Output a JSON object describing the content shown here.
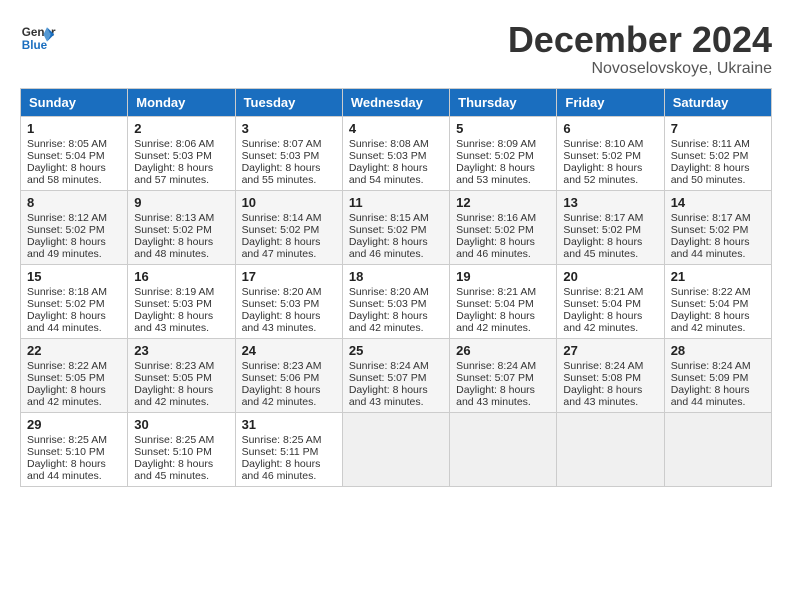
{
  "logo": {
    "line1": "General",
    "line2": "Blue"
  },
  "title": "December 2024",
  "location": "Novoselovskoye, Ukraine",
  "days_header": [
    "Sunday",
    "Monday",
    "Tuesday",
    "Wednesday",
    "Thursday",
    "Friday",
    "Saturday"
  ],
  "weeks": [
    [
      {
        "day": "1",
        "sunrise": "8:05 AM",
        "sunset": "5:04 PM",
        "daylight": "8 hours and 58 minutes."
      },
      {
        "day": "2",
        "sunrise": "8:06 AM",
        "sunset": "5:03 PM",
        "daylight": "8 hours and 57 minutes."
      },
      {
        "day": "3",
        "sunrise": "8:07 AM",
        "sunset": "5:03 PM",
        "daylight": "8 hours and 55 minutes."
      },
      {
        "day": "4",
        "sunrise": "8:08 AM",
        "sunset": "5:03 PM",
        "daylight": "8 hours and 54 minutes."
      },
      {
        "day": "5",
        "sunrise": "8:09 AM",
        "sunset": "5:02 PM",
        "daylight": "8 hours and 53 minutes."
      },
      {
        "day": "6",
        "sunrise": "8:10 AM",
        "sunset": "5:02 PM",
        "daylight": "8 hours and 52 minutes."
      },
      {
        "day": "7",
        "sunrise": "8:11 AM",
        "sunset": "5:02 PM",
        "daylight": "8 hours and 50 minutes."
      }
    ],
    [
      {
        "day": "8",
        "sunrise": "8:12 AM",
        "sunset": "5:02 PM",
        "daylight": "8 hours and 49 minutes."
      },
      {
        "day": "9",
        "sunrise": "8:13 AM",
        "sunset": "5:02 PM",
        "daylight": "8 hours and 48 minutes."
      },
      {
        "day": "10",
        "sunrise": "8:14 AM",
        "sunset": "5:02 PM",
        "daylight": "8 hours and 47 minutes."
      },
      {
        "day": "11",
        "sunrise": "8:15 AM",
        "sunset": "5:02 PM",
        "daylight": "8 hours and 46 minutes."
      },
      {
        "day": "12",
        "sunrise": "8:16 AM",
        "sunset": "5:02 PM",
        "daylight": "8 hours and 46 minutes."
      },
      {
        "day": "13",
        "sunrise": "8:17 AM",
        "sunset": "5:02 PM",
        "daylight": "8 hours and 45 minutes."
      },
      {
        "day": "14",
        "sunrise": "8:17 AM",
        "sunset": "5:02 PM",
        "daylight": "8 hours and 44 minutes."
      }
    ],
    [
      {
        "day": "15",
        "sunrise": "8:18 AM",
        "sunset": "5:02 PM",
        "daylight": "8 hours and 44 minutes."
      },
      {
        "day": "16",
        "sunrise": "8:19 AM",
        "sunset": "5:03 PM",
        "daylight": "8 hours and 43 minutes."
      },
      {
        "day": "17",
        "sunrise": "8:20 AM",
        "sunset": "5:03 PM",
        "daylight": "8 hours and 43 minutes."
      },
      {
        "day": "18",
        "sunrise": "8:20 AM",
        "sunset": "5:03 PM",
        "daylight": "8 hours and 42 minutes."
      },
      {
        "day": "19",
        "sunrise": "8:21 AM",
        "sunset": "5:04 PM",
        "daylight": "8 hours and 42 minutes."
      },
      {
        "day": "20",
        "sunrise": "8:21 AM",
        "sunset": "5:04 PM",
        "daylight": "8 hours and 42 minutes."
      },
      {
        "day": "21",
        "sunrise": "8:22 AM",
        "sunset": "5:04 PM",
        "daylight": "8 hours and 42 minutes."
      }
    ],
    [
      {
        "day": "22",
        "sunrise": "8:22 AM",
        "sunset": "5:05 PM",
        "daylight": "8 hours and 42 minutes."
      },
      {
        "day": "23",
        "sunrise": "8:23 AM",
        "sunset": "5:05 PM",
        "daylight": "8 hours and 42 minutes."
      },
      {
        "day": "24",
        "sunrise": "8:23 AM",
        "sunset": "5:06 PM",
        "daylight": "8 hours and 42 minutes."
      },
      {
        "day": "25",
        "sunrise": "8:24 AM",
        "sunset": "5:07 PM",
        "daylight": "8 hours and 43 minutes."
      },
      {
        "day": "26",
        "sunrise": "8:24 AM",
        "sunset": "5:07 PM",
        "daylight": "8 hours and 43 minutes."
      },
      {
        "day": "27",
        "sunrise": "8:24 AM",
        "sunset": "5:08 PM",
        "daylight": "8 hours and 43 minutes."
      },
      {
        "day": "28",
        "sunrise": "8:24 AM",
        "sunset": "5:09 PM",
        "daylight": "8 hours and 44 minutes."
      }
    ],
    [
      {
        "day": "29",
        "sunrise": "8:25 AM",
        "sunset": "5:10 PM",
        "daylight": "8 hours and 44 minutes."
      },
      {
        "day": "30",
        "sunrise": "8:25 AM",
        "sunset": "5:10 PM",
        "daylight": "8 hours and 45 minutes."
      },
      {
        "day": "31",
        "sunrise": "8:25 AM",
        "sunset": "5:11 PM",
        "daylight": "8 hours and 46 minutes."
      },
      null,
      null,
      null,
      null
    ]
  ]
}
